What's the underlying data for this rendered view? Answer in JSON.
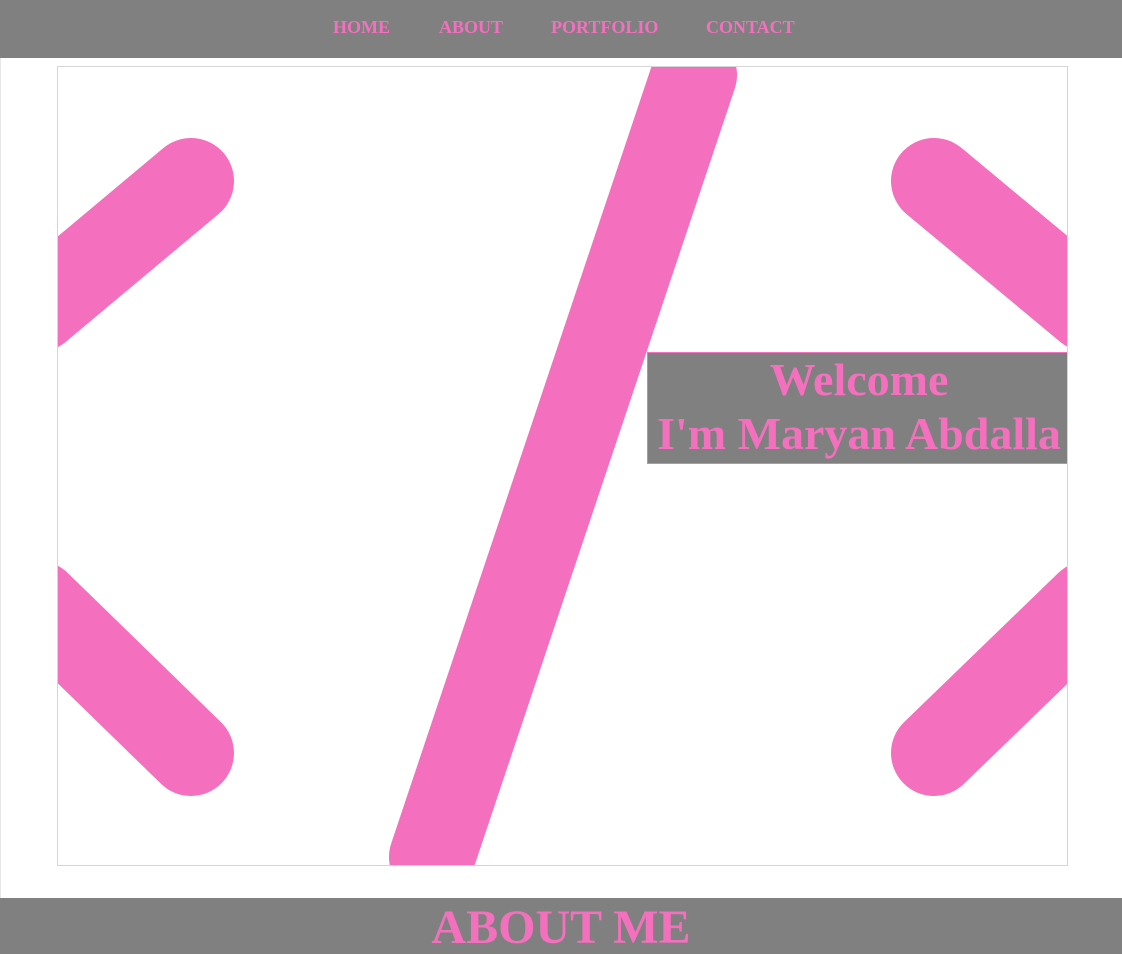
{
  "colors": {
    "accent": "#f46fbe",
    "nav_background": "#808080",
    "page_background": "#ffffff",
    "hero_border": "#d5d5d5"
  },
  "nav": {
    "items": [
      {
        "label": "HOME"
      },
      {
        "label": "ABOUT"
      },
      {
        "label": "PORTFOLIO"
      },
      {
        "label": "CONTACT"
      }
    ]
  },
  "hero": {
    "graphic": "code-brackets-slash-icon",
    "welcome_line": "Welcome",
    "name_line": "I'm Maryan Abdalla"
  },
  "about": {
    "heading": "ABOUT ME"
  }
}
